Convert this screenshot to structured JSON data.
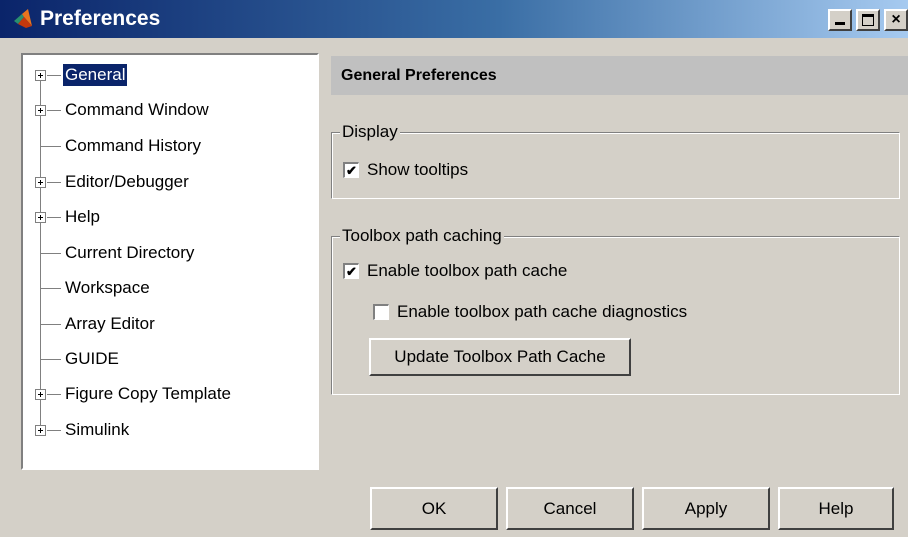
{
  "window": {
    "title": "Preferences"
  },
  "tree": {
    "items": [
      {
        "label": "General",
        "expandable": true,
        "selected": true
      },
      {
        "label": "Command Window",
        "expandable": true
      },
      {
        "label": "Command History",
        "expandable": false
      },
      {
        "label": "Editor/Debugger",
        "expandable": true
      },
      {
        "label": "Help",
        "expandable": true
      },
      {
        "label": "Current Directory",
        "expandable": false
      },
      {
        "label": "Workspace",
        "expandable": false
      },
      {
        "label": "Array Editor",
        "expandable": false
      },
      {
        "label": "GUIDE",
        "expandable": false
      },
      {
        "label": "Figure Copy Template",
        "expandable": true
      },
      {
        "label": "Simulink",
        "expandable": true
      }
    ]
  },
  "panel": {
    "header": "General Preferences",
    "display": {
      "legend": "Display",
      "show_tooltips": {
        "label": "Show tooltips",
        "checked": true
      }
    },
    "toolbox": {
      "legend": "Toolbox path caching",
      "enable_cache": {
        "label": "Enable toolbox path cache",
        "checked": true
      },
      "enable_diag": {
        "label": "Enable toolbox path cache diagnostics",
        "checked": false
      },
      "update_button": "Update Toolbox Path Cache"
    }
  },
  "buttons": {
    "ok": "OK",
    "cancel": "Cancel",
    "apply": "Apply",
    "help": "Help"
  },
  "check_mark": "✔"
}
